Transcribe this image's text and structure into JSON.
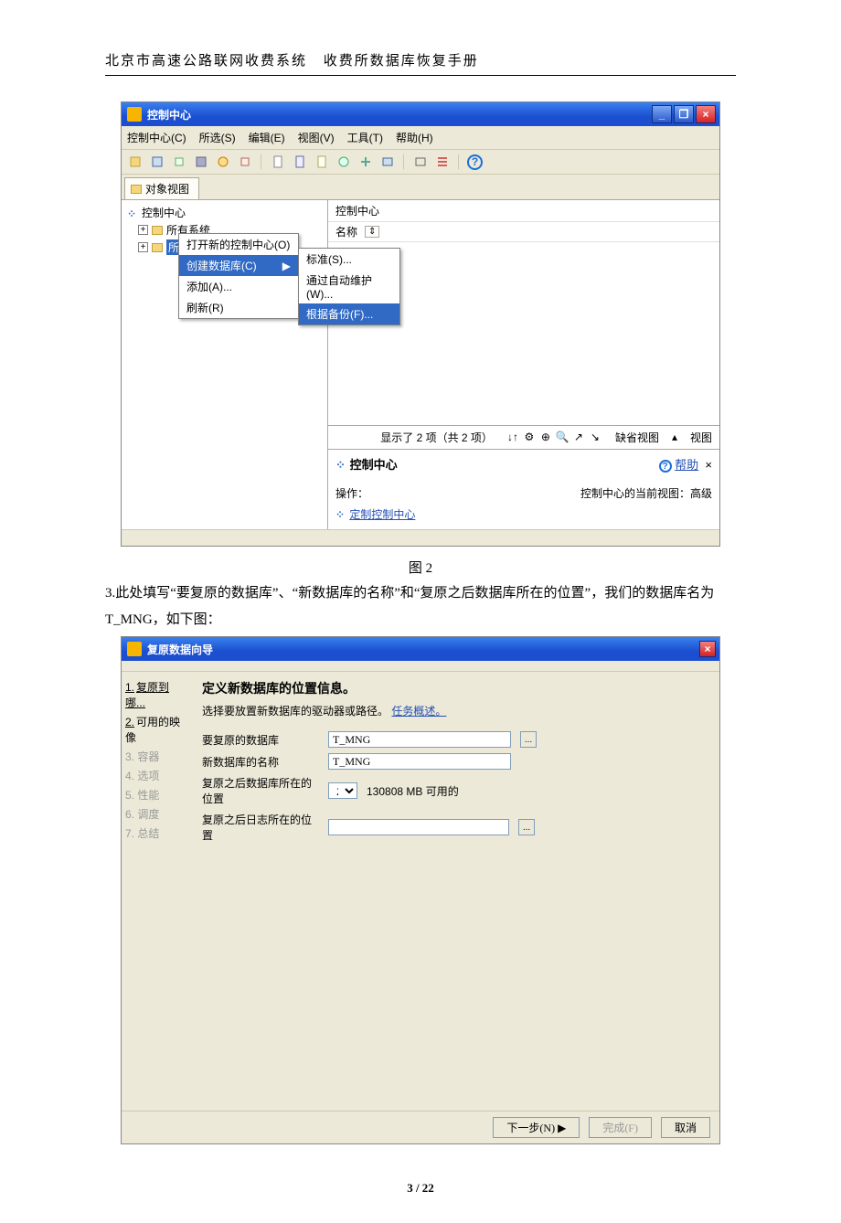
{
  "doc": {
    "header1": "北京市高速公路联网收费系统",
    "header2": "收费所数据库恢复手册",
    "fig2": "图 2",
    "para3": "3.此处填写“要复原的数据库”、“新数据库的名称”和“复原之后数据库所在的位置”，我们的数据库名为 T_MNG，如下图：",
    "page": "3 / 22"
  },
  "win1": {
    "title": "控制中心",
    "menus": [
      "控制中心(C)",
      "所选(S)",
      "编辑(E)",
      "视图(V)",
      "工具(T)",
      "帮助(H)"
    ],
    "tab": "对象视图",
    "tree": {
      "root": "控制中心",
      "n1": "所有系统",
      "n2": "所有",
      "ctx": {
        "open": "打开新的控制中心(O)",
        "create": "创建数据库(C)",
        "add": "添加(A)...",
        "refresh": "刷新(R)"
      },
      "sub": {
        "std": "标准(S)...",
        "auto": "通过自动维护(W)...",
        "bak": "根据备份(F)..."
      }
    },
    "right": {
      "hdr": "控制中心",
      "col": "名称",
      "row1": "所有系统",
      "status": "显示了 2 项（共 2 项）",
      "defview": "缺省视图",
      "view": "视图",
      "info_title": "控制中心",
      "help": "帮助",
      "ops": "操作：",
      "link": "定制控制中心",
      "cur": "控制中心的当前视图：高级"
    }
  },
  "win2": {
    "title": "复原数据向导",
    "steps": [
      "复原到哪...",
      "可用的映像",
      "容器",
      "选项",
      "性能",
      "调度",
      "总结"
    ],
    "htitle": "定义新数据库的位置信息。",
    "sub": "选择要放置新数据库的驱动器或路径。",
    "sublink": "任务概述。",
    "labels": {
      "db": "要复原的数据库",
      "newname": "新数据库的名称",
      "dbloc": "复原之后数据库所在的位置",
      "logloc": "复原之后日志所在的位置"
    },
    "values": {
      "db": "T_MNG",
      "newname": "T_MNG",
      "drive": "Z",
      "avail": "130808 MB 可用的"
    },
    "btns": {
      "next": "下一步(N) ▶",
      "finish": "完成(F)",
      "cancel": "取消"
    }
  }
}
